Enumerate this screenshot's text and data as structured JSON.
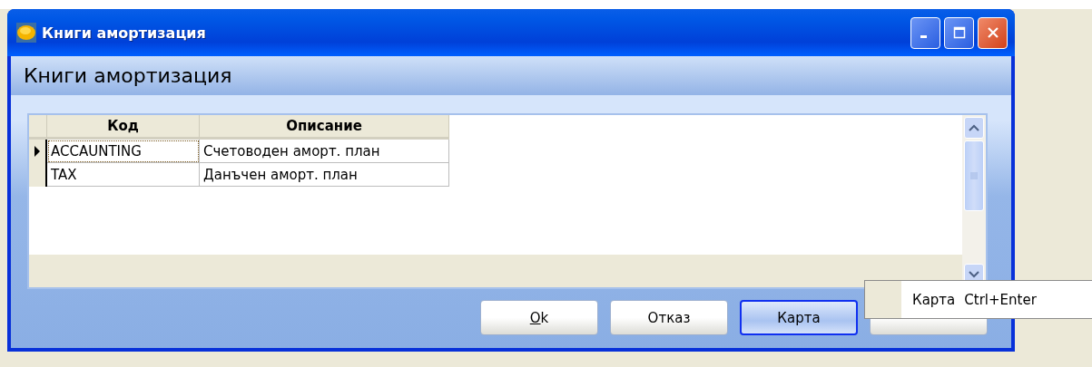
{
  "window": {
    "title": "Книги амортизация"
  },
  "header": "Книги амортизация",
  "table": {
    "columns": [
      "Код",
      "Описание"
    ],
    "rows": [
      {
        "cells": [
          "ACCAUNTING",
          "Счетоводен аморт. план"
        ],
        "selected": true
      },
      {
        "cells": [
          "TAX",
          "Данъчен аморт. план"
        ],
        "selected": false
      }
    ]
  },
  "buttons": [
    {
      "access_key": "O",
      "label_rest": "k",
      "focused": false
    },
    {
      "label": "Отказ",
      "focused": false
    },
    {
      "label": "Карта",
      "focused": true
    },
    {
      "focused": false
    }
  ],
  "context_menu": {
    "items": [
      {
        "label": "Карта",
        "shortcut": "Ctrl+Enter"
      }
    ]
  }
}
